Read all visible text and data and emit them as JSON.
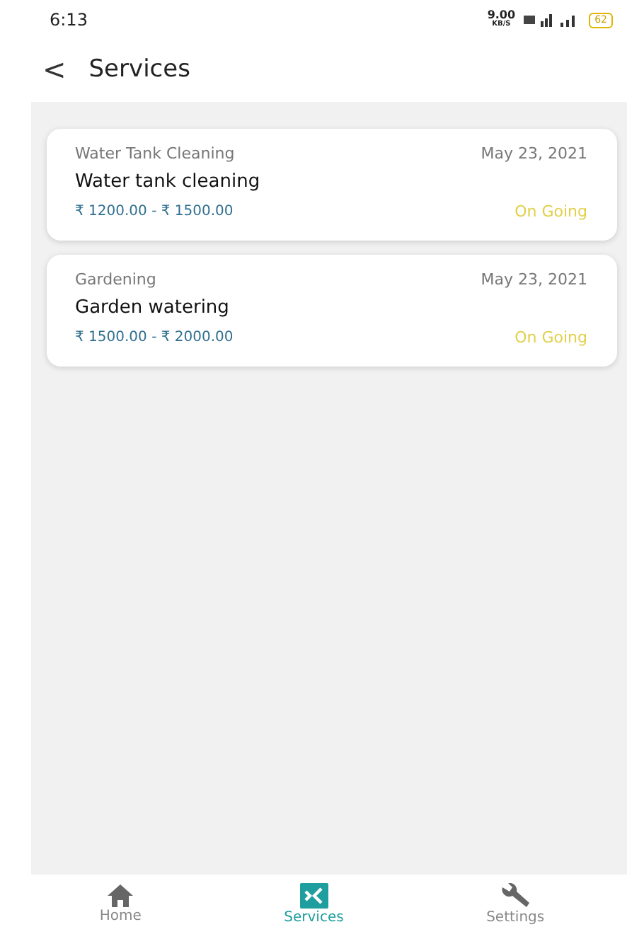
{
  "status_bar": {
    "time": "6:13",
    "speed": "9.00",
    "speed_unit": "KB/S",
    "battery": "62"
  },
  "header": {
    "back": "<",
    "title": "Services"
  },
  "services": [
    {
      "category": "Water Tank Cleaning",
      "date": "May 23, 2021",
      "title": "Water tank cleaning",
      "price": "₹ 1200.00 - ₹ 1500.00",
      "status": "On Going"
    },
    {
      "category": "Gardening",
      "date": "May 23, 2021",
      "title": "Garden watering",
      "price": "₹ 1500.00 - ₹ 2000.00",
      "status": "On Going"
    }
  ],
  "nav": [
    {
      "kind": "home",
      "label": "Home",
      "selected": false
    },
    {
      "kind": "services",
      "label": "Services",
      "selected": true
    },
    {
      "kind": "settings",
      "label": "Settings",
      "selected": false
    }
  ]
}
